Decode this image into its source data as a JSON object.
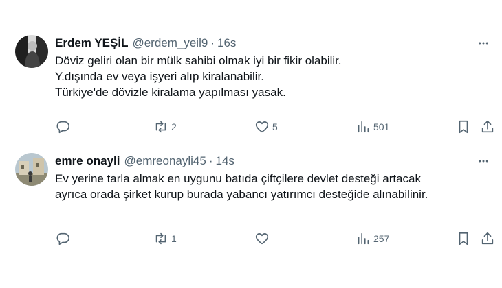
{
  "tweets": [
    {
      "name": "Erdem YEŞİL",
      "handle": "@erdem_yeil9",
      "time": "16s",
      "lines": [
        "Döviz geliri olan bir mülk sahibi olmak iyi bir fikir olabilir.",
        "Y.dışında ev veya işyeri  alıp kiralanabilir.",
        "Türkiye'de dövizle kiralama yapılması yasak."
      ],
      "replies": "",
      "retweets": "2",
      "likes": "5",
      "views": "501"
    },
    {
      "name": "emre onayli",
      "handle": "@emreonayli45",
      "time": "14s",
      "lines": [
        "Ev yerine tarla almak en uygunu batıda çiftçilere devlet desteği artacak",
        "ayrıca orada şirket kurup burada yabancı yatırımcı  desteğide alınabilinir."
      ],
      "replies": "",
      "retweets": "1",
      "likes": "",
      "views": "257"
    }
  ],
  "separator": "·",
  "icons": {
    "more": "more-dots-icon",
    "reply": "reply-icon",
    "retweet": "retweet-icon",
    "like": "heart-icon",
    "views": "views-icon",
    "bookmark": "bookmark-icon",
    "share": "share-icon"
  },
  "colors": {
    "text": "#0f1419",
    "secondary": "#536471",
    "border": "#eff3f4"
  }
}
